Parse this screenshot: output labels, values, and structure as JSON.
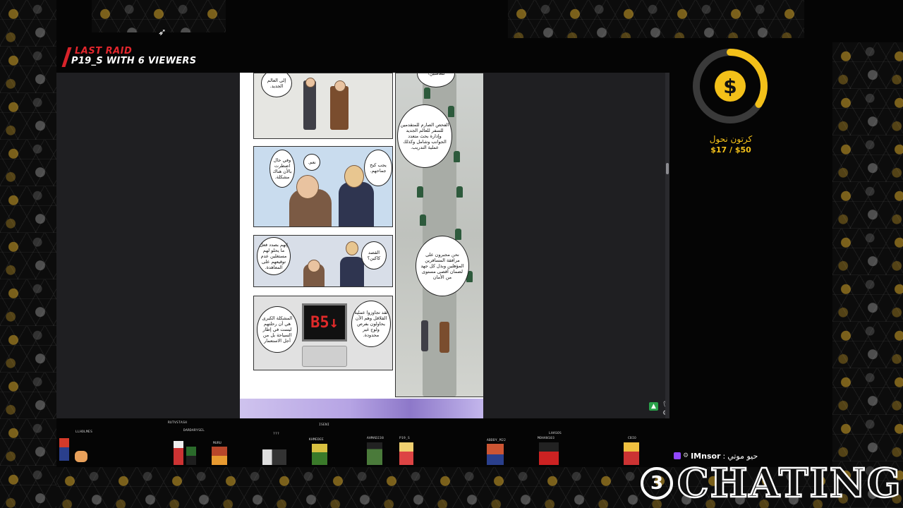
{
  "raid": {
    "title": "LAST RAID",
    "subtitle": "P19_S WITH 6 VIEWERS"
  },
  "goal": {
    "label": "كرتون نحول",
    "amount": "$17 / $50",
    "progress": 0.34,
    "symbol": "$"
  },
  "manga": {
    "bubbles": [
      "إلى العالم الجديد.",
      "للعاملين؟",
      "وفي حال اضطرت بالأن هناك مشكلة.",
      "نعم.",
      "يجب كبح جماحهم.",
      "الفحص الصارم للمتقدمين للسفر للعالم الجديد وإدارة بحث متعدد الجوانب وشامل وكذلك عملية التدريب.",
      "إنهم بصدد فعل ما يحلو لهم مستغلين عدم توقيعهم على المعاهدة.",
      "القصد كاكين؟",
      "نحن مجبرون على مرافقة المسافرين المؤهلين وبذل كل جهد لضمان أقصى مستوى من الأمان",
      "المشكلة الكبرى هي أن رحلتهم ليست في إطار السياحة بل من أجل الاستعمار",
      "لقد تجاوزوا عملية القلاقل وهم الآن يحاولون بفرص ولوج غير محدودة."
    ],
    "elevator_display": "B5↓"
  },
  "viewers": [
    {
      "name": "LLHOLMES"
    },
    {
      "name": "RUTVSTASH"
    },
    {
      "name": "DARDARYSEL"
    },
    {
      "name": "MURU"
    },
    {
      "name": "???"
    },
    {
      "name": "ISENI"
    },
    {
      "name": "KHMEDEE"
    },
    {
      "name": "AHMAD238"
    },
    {
      "name": "P19_S"
    },
    {
      "name": "ABDDY_M22"
    },
    {
      "name": "LHASOS"
    },
    {
      "name": "MOHAN103"
    },
    {
      "name": "CBIO"
    }
  ],
  "chat": {
    "user": "IMnsor",
    "message": "حيو موتي",
    "separator": ":"
  },
  "logo": {
    "circle": "3",
    "text": "CHATING"
  },
  "icons": {
    "mic": "microphone-icon",
    "gear": "gear-icon",
    "up": "chevron-up-icon",
    "cursor": "cursor-icon"
  },
  "colors": {
    "accent_gold": "#f3c019",
    "raid_red": "#e3262d",
    "twitch_purple": "#9147ff"
  }
}
